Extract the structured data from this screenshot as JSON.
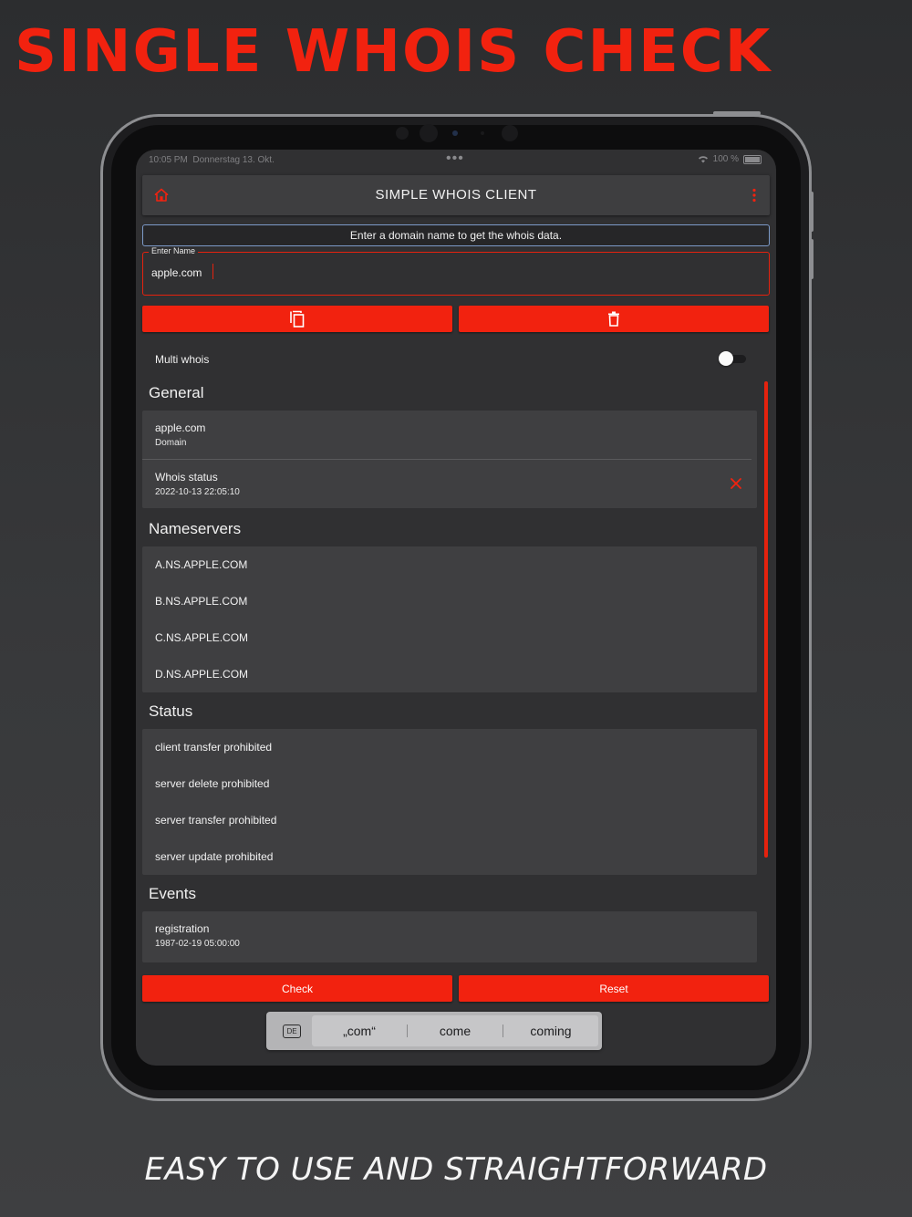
{
  "promo": {
    "headline": "SINGLE WHOIS CHECK",
    "tagline": "EASY TO USE AND STRAIGHTFORWARD"
  },
  "status_bar": {
    "time": "10:05 PM",
    "date": "Donnerstag 13. Okt.",
    "battery": "100 %"
  },
  "app_bar": {
    "title": "SIMPLE WHOIS CLIENT",
    "left_icon": "home-icon",
    "right_icon": "more-vert-icon"
  },
  "info_text": "Enter a domain name to get the whois data.",
  "name_field": {
    "label": "Enter Name",
    "value": "apple.com"
  },
  "action_buttons": {
    "copy_icon": "copy-icon",
    "delete_icon": "trash-icon"
  },
  "multi_whois": {
    "label": "Multi whois",
    "enabled": false
  },
  "general": {
    "title": "General",
    "domain_value": "apple.com",
    "domain_label": "Domain",
    "whois_status_label": "Whois status",
    "whois_status_time": "2022-10-13 22:05:10"
  },
  "nameservers": {
    "title": "Nameservers",
    "items": [
      "A.NS.APPLE.COM",
      "B.NS.APPLE.COM",
      "C.NS.APPLE.COM",
      "D.NS.APPLE.COM"
    ]
  },
  "status": {
    "title": "Status",
    "items": [
      "client transfer prohibited",
      "server delete prohibited",
      "server transfer prohibited",
      "server update prohibited"
    ]
  },
  "events": {
    "title": "Events",
    "items": [
      {
        "name": "registration",
        "date": "1987-02-19 05:00:00"
      }
    ]
  },
  "bottom_buttons": {
    "check": "Check",
    "reset": "Reset"
  },
  "keyboard_suggestions": {
    "language": "DE",
    "words": [
      "„com“",
      "come",
      "coming"
    ]
  },
  "colors": {
    "accent": "#f2220f",
    "background": "#303032",
    "card": "#3f3f41",
    "info_border": "#7c9ac8"
  }
}
